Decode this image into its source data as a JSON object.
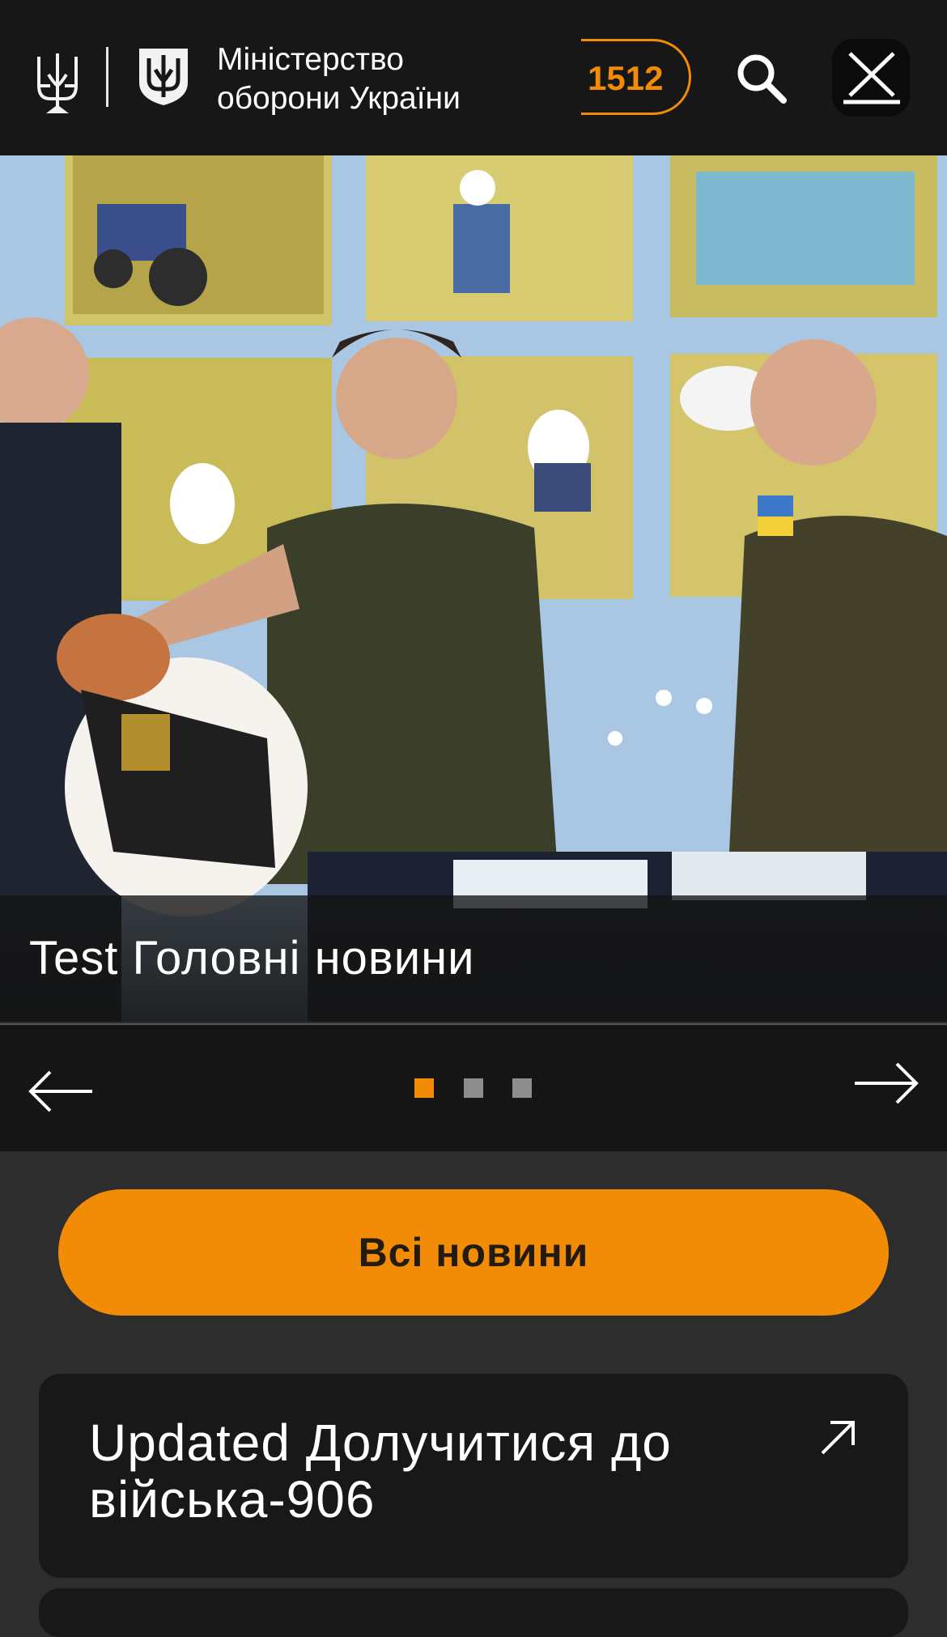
{
  "header": {
    "ministry_name": "Міністерство оборони України",
    "hotline": "1512"
  },
  "hero": {
    "caption": "Test Головні новини"
  },
  "slider": {
    "total_slides": 3,
    "active_slide": 1
  },
  "buttons": {
    "all_news": "Всі новини"
  },
  "cards": [
    {
      "title": "Updated Долучитися до війська-906"
    }
  ],
  "colors": {
    "accent": "#f28c06",
    "header_bg": "#171717",
    "page_bg": "#2d2d2d",
    "card_bg": "#181818"
  }
}
